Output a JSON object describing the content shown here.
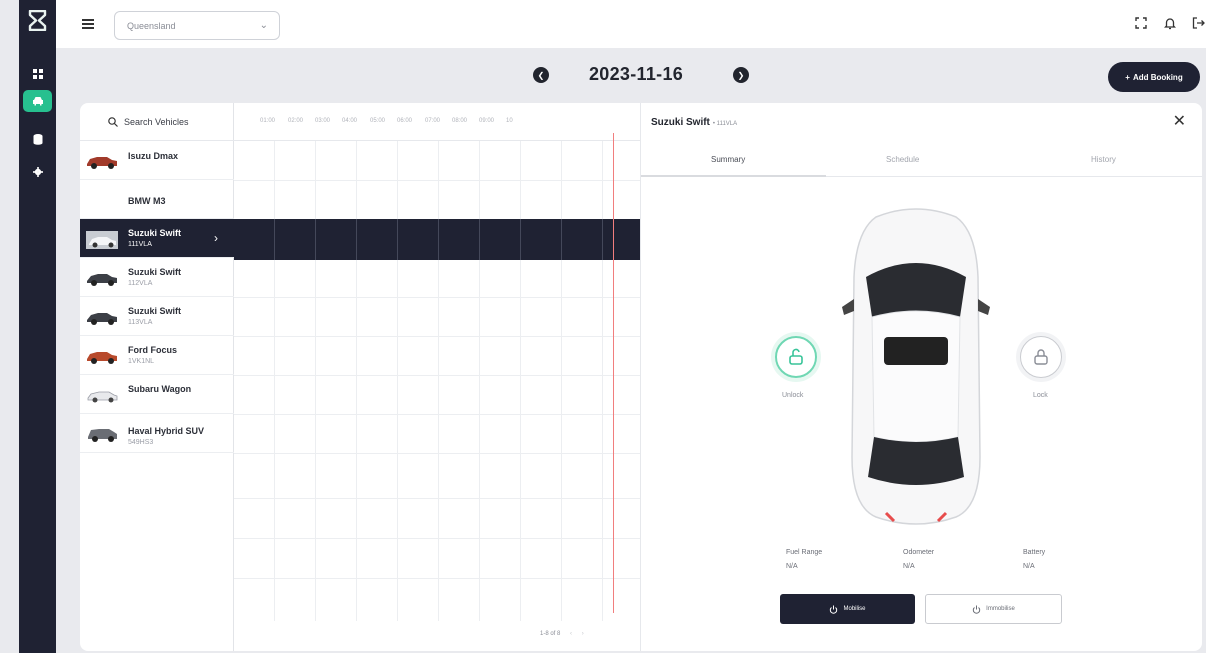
{
  "topbar": {
    "region": "Queensland",
    "icons": [
      "fullscreen-icon",
      "bell-icon",
      "logout-icon"
    ]
  },
  "nav": {
    "items": [
      "dashboard-icon",
      "car-icon",
      "database-icon",
      "settings-icon"
    ],
    "active": "car-icon"
  },
  "datebar": {
    "date": "2023-11-16",
    "add_booking": "Add Booking"
  },
  "search": {
    "label": "Search Vehicles"
  },
  "timeline": {
    "hours": [
      "01:00",
      "02:00",
      "03:00",
      "04:00",
      "05:00",
      "06:00",
      "07:00",
      "08:00",
      "09:00",
      "10"
    ]
  },
  "vehicles": [
    {
      "name": "Isuzu Dmax",
      "plate": ""
    },
    {
      "name": "BMW M3",
      "plate": ""
    },
    {
      "name": "Suzuki Swift",
      "plate": "111VLA"
    },
    {
      "name": "Suzuki Swift",
      "plate": "112VLA"
    },
    {
      "name": "Suzuki Swift",
      "plate": "113VLA"
    },
    {
      "name": "Ford Focus",
      "plate": "1VK1NL"
    },
    {
      "name": "Subaru Wagon",
      "plate": ""
    },
    {
      "name": "Haval Hybrid SUV",
      "plate": "549HS3"
    }
  ],
  "pager": {
    "label": "1-8 of 8"
  },
  "detail": {
    "title": "Suzuki Swift",
    "plate": "• 111VLA",
    "tabs": [
      "Summary",
      "Schedule",
      "History"
    ],
    "active_tab": "Summary",
    "unlock": "Unlock",
    "lock": "Lock",
    "stats": [
      {
        "label": "Fuel Range",
        "value": "N/A"
      },
      {
        "label": "Odometer",
        "value": "N/A"
      },
      {
        "label": "Battery",
        "value": "N/A"
      }
    ],
    "mobilise": "Mobilise",
    "immobilise": "Immobilise"
  },
  "colors": {
    "navy": "#1f2233",
    "accent_green": "#27c08f",
    "now_line": "#f17e7e"
  }
}
